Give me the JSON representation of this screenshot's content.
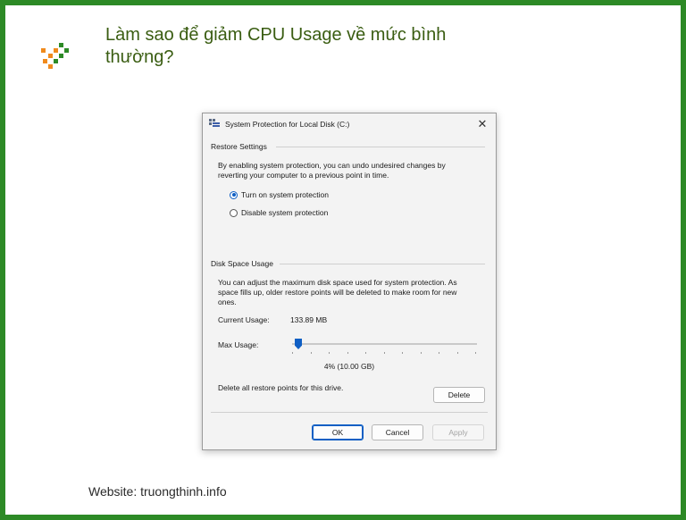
{
  "article": {
    "title": "Làm sao để giảm CPU Usage về mức bình thường?",
    "footer": "Website: truongthinh.info",
    "brand_color": "#2d8a26"
  },
  "dialog": {
    "title": "System Protection for Local Disk (C:)",
    "restore_settings": {
      "heading": "Restore Settings",
      "description": "By enabling system protection, you can undo undesired changes by reverting your computer to a previous point in time.",
      "options": [
        {
          "label": "Turn on system protection",
          "selected": true
        },
        {
          "label": "Disable system protection",
          "selected": false
        }
      ]
    },
    "disk_space": {
      "heading": "Disk Space Usage",
      "description": "You can adjust the maximum disk space used for system protection. As space fills up, older restore points will be deleted to make room for new ones.",
      "current_usage_label": "Current Usage:",
      "current_usage_value": "133.89 MB",
      "max_usage_label": "Max Usage:",
      "max_usage_percent": 4,
      "max_usage_readout": "4% (10.00 GB)",
      "delete_text": "Delete all restore points for this drive.",
      "delete_button": "Delete"
    },
    "buttons": {
      "ok": "OK",
      "cancel": "Cancel",
      "apply": "Apply"
    },
    "accent_color": "#0f5fc4"
  }
}
